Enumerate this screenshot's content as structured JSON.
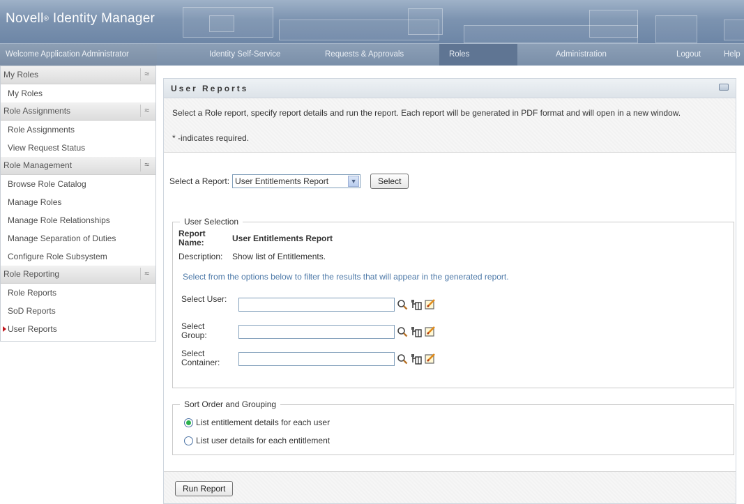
{
  "header": {
    "brand": "Novell",
    "brand_reg": "®",
    "brand_rest": " Identity Manager"
  },
  "nav": {
    "welcome": "Welcome Application Administrator",
    "items": [
      "Identity Self-Service",
      "Requests & Approvals",
      "Roles",
      "Administration",
      "Logout",
      "Help"
    ],
    "active": "Roles"
  },
  "sidebar": {
    "sections": [
      {
        "title": "My Roles",
        "items": [
          "My Roles"
        ]
      },
      {
        "title": "Role Assignments",
        "items": [
          "Role Assignments",
          "View Request Status"
        ]
      },
      {
        "title": "Role Management",
        "items": [
          "Browse Role Catalog",
          "Manage Roles",
          "Manage Role Relationships",
          "Manage Separation of Duties",
          "Configure Role Subsystem"
        ]
      },
      {
        "title": "Role Reporting",
        "items": [
          "Role Reports",
          "SoD Reports",
          "User Reports"
        ]
      }
    ],
    "collapse_glyph": "≈",
    "current_item": "User Reports"
  },
  "panel": {
    "title": "User Reports",
    "intro": "Select a Role report, specify report details and run the report. Each report will be generated in PDF format and will open in a new window.",
    "required_note": "* -indicates required.",
    "select_report_label": "Select a Report:",
    "select_report_value": "User Entitlements Report",
    "select_button": "Select",
    "user_selection": {
      "legend": "User Selection",
      "report_name_label": "Report Name:",
      "report_name_value": "User Entitlements Report",
      "description_label": "Description:",
      "description_value": "Show list of Entitlements.",
      "hint": "Select from the options below to filter the results that will appear in the generated report.",
      "pickers": [
        {
          "label": "Select User:",
          "value": ""
        },
        {
          "label": "Select Group:",
          "value": ""
        },
        {
          "label": "Select Container:",
          "value": ""
        }
      ]
    },
    "sort": {
      "legend": "Sort Order and Grouping",
      "options": [
        "List entitlement details for each user",
        "List user details for each entitlement"
      ],
      "selected_index": 0
    },
    "run_button": "Run Report"
  },
  "colors": {
    "banner": "#7c93b0",
    "navbar": "#7a8fa9",
    "nav_active": "#5f7593",
    "hint_text": "#4d79a8",
    "radio_on": "#2bb24c",
    "current_marker": "#c0141b"
  }
}
